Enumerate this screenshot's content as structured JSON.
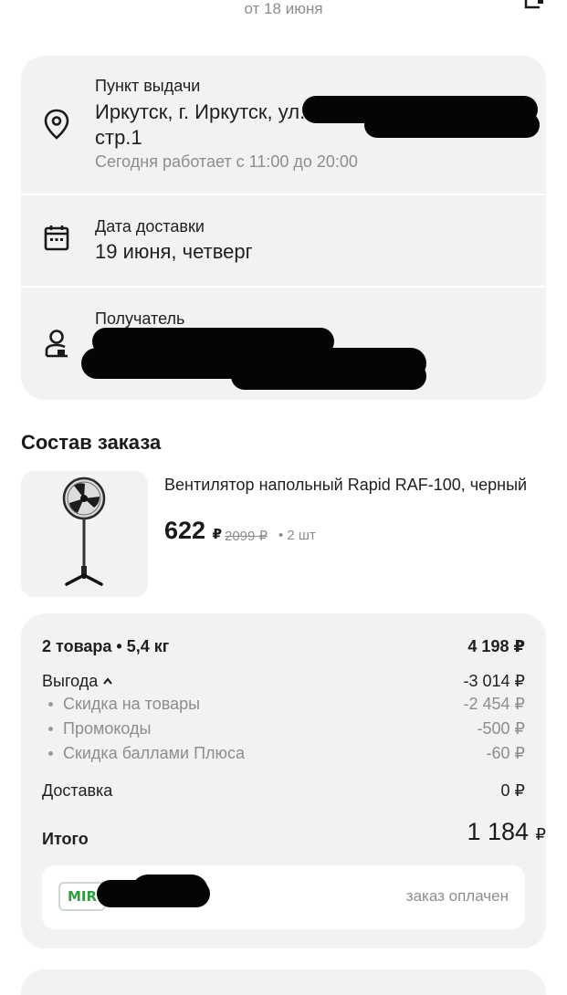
{
  "header": {
    "subtitle": "от 18 июня"
  },
  "pickup": {
    "label": "Пункт выдачи",
    "address_line1": "Иркутск, г. Иркутск, ул.",
    "address_line2": "стр.1",
    "hours": "Сегодня работает с 11:00 до 20:00",
    "icon": "location-pin-icon"
  },
  "delivery": {
    "label": "Дата доставки",
    "date": "19 июня, четверг",
    "icon": "calendar-icon"
  },
  "recipient": {
    "label": "Получатель",
    "icon": "recipient-icon"
  },
  "order": {
    "section_title": "Состав заказа",
    "item": {
      "name": "Вентилятор напольный Rapid RAF-100, черный",
      "price": "622",
      "currency": "₽",
      "old_price": "2099 ₽",
      "qty": "• 2 шт"
    }
  },
  "summary": {
    "items_label": "2 товара • 5,4 кг",
    "items_total": "4 198 ₽",
    "benefit_label": "Выгода",
    "benefit_value": "-3 014 ₽",
    "discounts": [
      {
        "label": "Скидка на товары",
        "value": "-2 454 ₽"
      },
      {
        "label": "Промокоды",
        "value": "-500 ₽"
      },
      {
        "label": "Скидка баллами Плюса",
        "value": "-60 ₽"
      }
    ],
    "delivery_label": "Доставка",
    "delivery_value": "0 ₽",
    "total_label": "Итого",
    "total_value": "1 184",
    "total_currency": "₽"
  },
  "payment": {
    "logo_text": "MIR",
    "card_mask": "••••",
    "status": "заказ оплачен"
  },
  "colors": {
    "card_bg": "#f2f2f1",
    "muted": "#8d8d8d",
    "mir_green": "#2e9d3a"
  }
}
